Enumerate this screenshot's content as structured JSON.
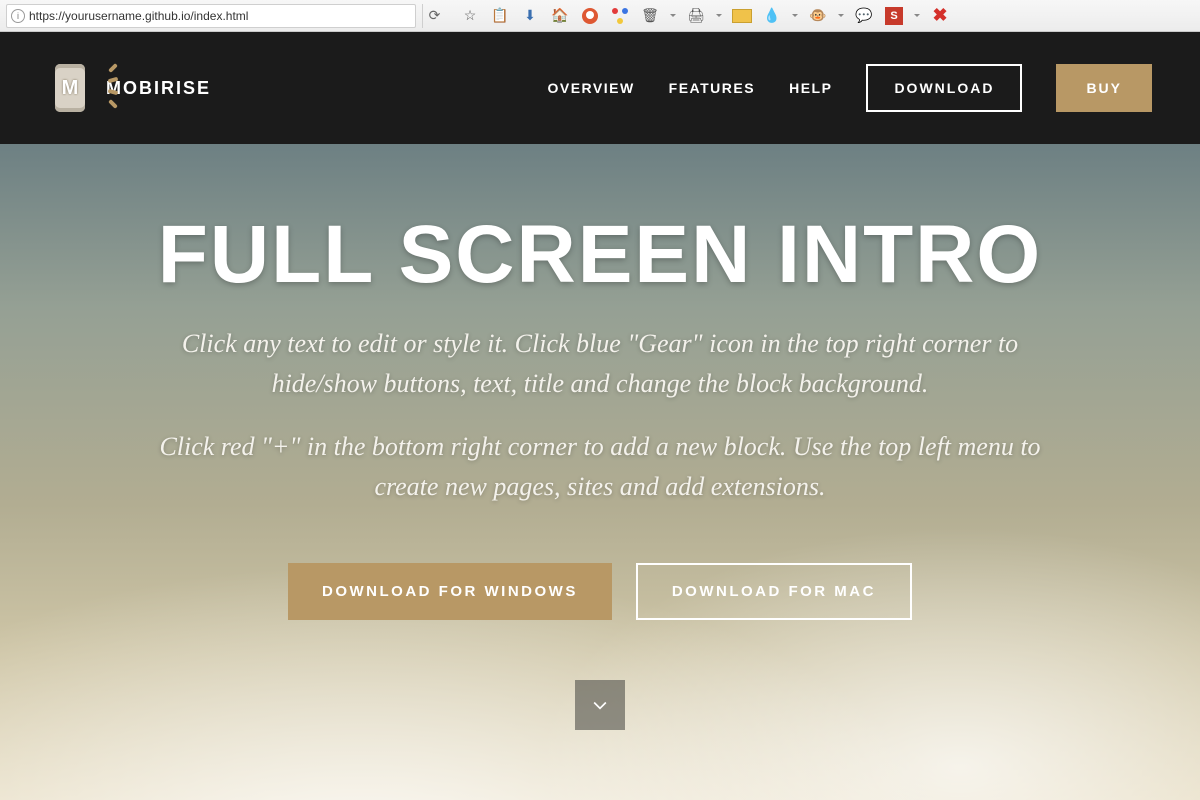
{
  "browser": {
    "url": "https://yourusername.github.io/index.html"
  },
  "header": {
    "brand": "MOBIRISE",
    "nav": {
      "overview": "OVERVIEW",
      "features": "FEATURES",
      "help": "HELP"
    },
    "download": "DOWNLOAD",
    "buy": "BUY"
  },
  "hero": {
    "title": "FULL SCREEN INTRO",
    "p1": "Click any text to edit or style it. Click blue \"Gear\" icon in the top right corner to hide/show buttons, text, title and change the block background.",
    "p2": "Click red \"+\" in the bottom right corner to add a new block. Use the top left menu to create new pages, sites and add extensions.",
    "btn_windows": "DOWNLOAD FOR WINDOWS",
    "btn_mac": "DOWNLOAD FOR MAC"
  },
  "colors": {
    "accent": "#b89865",
    "header_bg": "#1b1b1b"
  }
}
